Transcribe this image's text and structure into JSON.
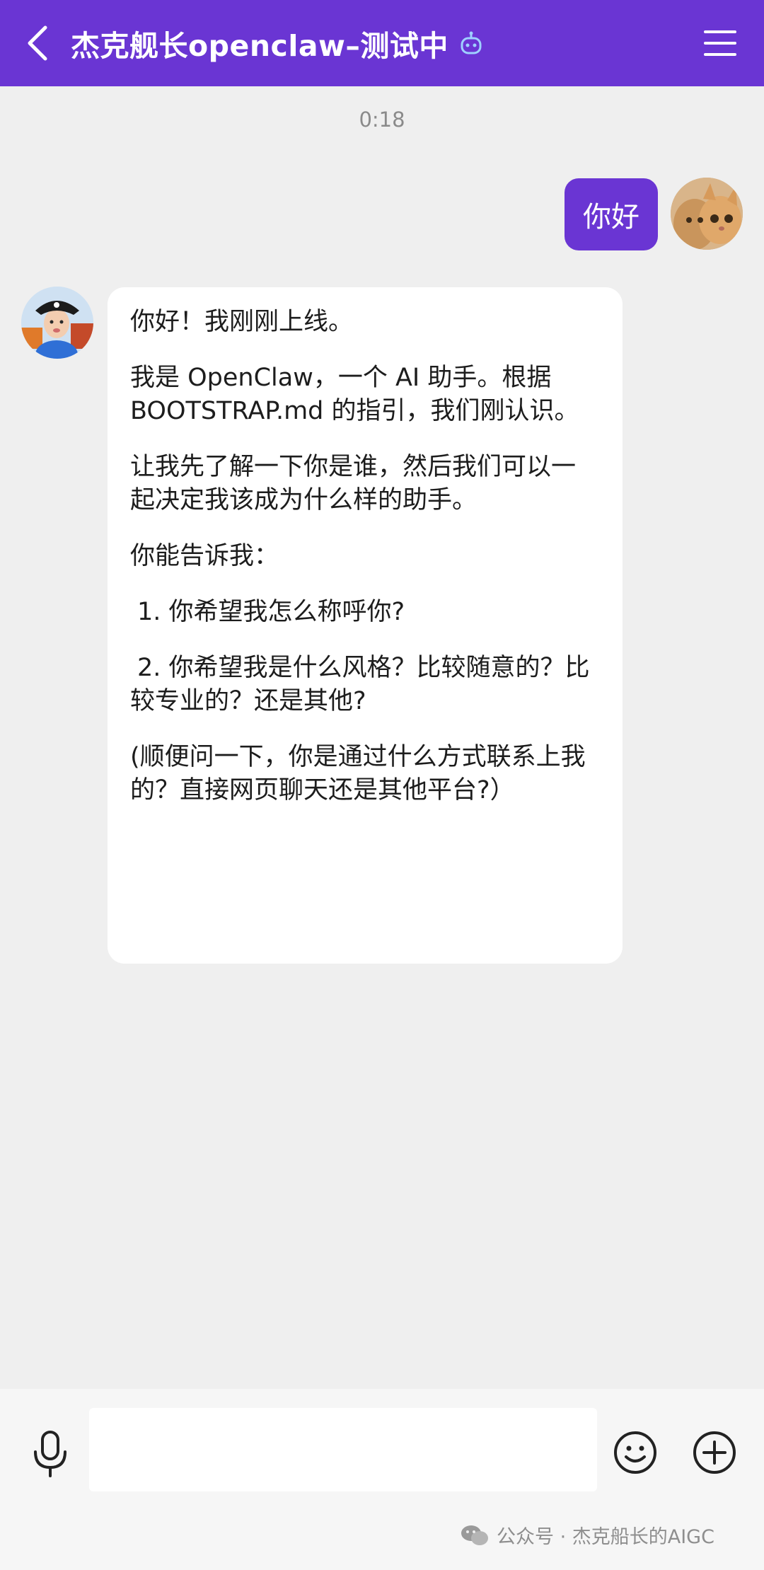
{
  "header": {
    "title": "杰克舰长openclaw–测试中",
    "back_icon": "chevron-left-icon",
    "bot_icon": "robot-icon",
    "menu_icon": "hamburger-menu-icon",
    "accent_color": "#6a35d3"
  },
  "chat": {
    "timestamp": "0:18",
    "user_message": "你好",
    "bot_message": {
      "paragraphs": [
        "你好！我刚刚上线。",
        "我是 OpenClaw，一个 AI 助手。根据 BOOTSTRAP.md 的指引，我们刚认识。",
        "让我先了解一下你是谁，然后我们可以一起决定我该成为什么样的助手。",
        "你能告诉我："
      ],
      "items": [
        "1. 你希望我怎么称呼你?",
        "2. 你希望我是什么风格？比较随意的？比较专业的？还是其他?"
      ],
      "closing": "(顺便问一下，你是通过什么方式联系上我的？直接网页聊天还是其他平台?）"
    }
  },
  "composer": {
    "input_value": "",
    "mic_icon": "microphone-icon",
    "emoji_icon": "emoji-icon",
    "plus_icon": "plus-circle-icon"
  },
  "watermark": {
    "text": "公众号 · 杰克船长的AIGC",
    "icon": "wechat-icon"
  }
}
